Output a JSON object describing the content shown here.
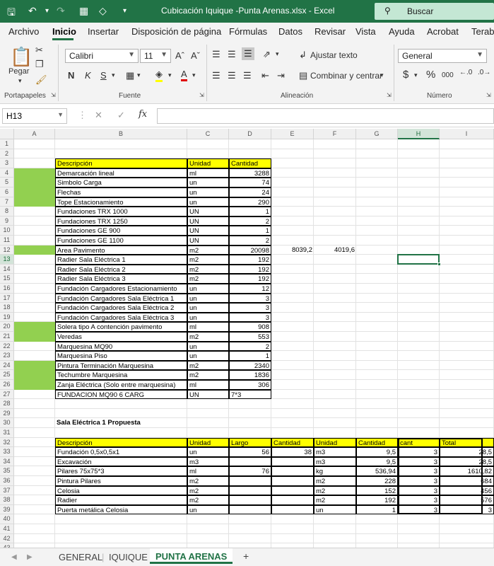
{
  "titlebar": {
    "title": "Cubicación Iquique -Punta Arenas.xlsx  -  Excel",
    "search_label": "Buscar",
    "save_icon": "save-icon",
    "undo_icon": "undo-icon",
    "redo_icon": "redo-icon"
  },
  "ribbon_tabs": [
    "Archivo",
    "Inicio",
    "Insertar",
    "Disposición de página",
    "Fórmulas",
    "Datos",
    "Revisar",
    "Vista",
    "Ayuda",
    "Acrobat",
    "Terabo"
  ],
  "ribbon": {
    "paste_label": "Pegar",
    "font_name": "Calibri",
    "font_size": "11",
    "wrap_text_label": "Ajustar texto",
    "merge_label": "Combinar y centrar",
    "number_format": "General",
    "groups": {
      "clipboard": "Portapapeles",
      "font": "Fuente",
      "alignment": "Alineación",
      "number": "Número"
    },
    "bold": "N",
    "italic": "K",
    "underline": "S",
    "increase_font": "A^",
    "decrease_font": "A˅",
    "currency": "$",
    "percent": "%",
    "thousands": "000"
  },
  "formula_bar": {
    "name_box": "H13",
    "fx": "fx",
    "cancel": "✕",
    "enter": "✓",
    "content": ""
  },
  "columns": [
    "A",
    "B",
    "C",
    "D",
    "E",
    "F",
    "G",
    "H",
    "I"
  ],
  "selected_column": "H",
  "selected_row": 13,
  "rows": [
    1,
    2,
    3,
    4,
    5,
    6,
    7,
    8,
    9,
    10,
    11,
    12,
    13,
    14,
    15,
    16,
    17,
    18,
    19,
    20,
    21,
    22,
    23,
    24,
    25,
    26,
    27,
    28,
    29,
    30,
    31,
    32,
    33,
    34,
    35,
    36,
    37,
    38,
    39,
    40,
    41,
    42,
    43
  ],
  "table1": {
    "headers": [
      "Descripción",
      "Unidad",
      "Cantidad"
    ],
    "rows": [
      {
        "desc": "Demarcación lineal",
        "unit": "ml",
        "qty": "3288",
        "green": true
      },
      {
        "desc": "Simbolo Carga",
        "unit": "un",
        "qty": "74",
        "green": true
      },
      {
        "desc": "Flechas",
        "unit": "un",
        "qty": "24",
        "green": true
      },
      {
        "desc": "Tope Estacionamiento",
        "unit": "un",
        "qty": "290",
        "green": true
      },
      {
        "desc": "Fundaciones TRX 1000",
        "unit": "UN",
        "qty": "1",
        "green": false
      },
      {
        "desc": "Fundaciones TRX 1250",
        "unit": "UN",
        "qty": "2",
        "green": false
      },
      {
        "desc": "Fundaciones GE 900",
        "unit": "UN",
        "qty": "1",
        "green": false
      },
      {
        "desc": "Fundaciones GE 1100",
        "unit": "UN",
        "qty": "2",
        "green": false
      },
      {
        "desc": "Area Pavimento",
        "unit": "m2",
        "qty": "20098",
        "green": true,
        "e": "8039,2",
        "f": "4019,6"
      },
      {
        "desc": "Radier Sala Eléctrica 1",
        "unit": "m2",
        "qty": "192",
        "green": false
      },
      {
        "desc": "Radier Sala Eléctrica 2",
        "unit": "m2",
        "qty": "192",
        "green": false
      },
      {
        "desc": "Radier Sala Eléctrica 3",
        "unit": "m2",
        "qty": "192",
        "green": false
      },
      {
        "desc": "Fundación Cargadores Estacionamiento",
        "unit": "un",
        "qty": "12",
        "green": false
      },
      {
        "desc": "Fundación Cargadores Sala Eléctrica 1",
        "unit": "un",
        "qty": "3",
        "green": false
      },
      {
        "desc": "Fundación Cargadores Sala Eléctrica 2",
        "unit": "un",
        "qty": "3",
        "green": false
      },
      {
        "desc": "Fundación Cargadores Sala Eléctrica 3",
        "unit": "un",
        "qty": "3",
        "green": false
      },
      {
        "desc": "Solera tipo A contención pavimento",
        "unit": "ml",
        "qty": "908",
        "green": true
      },
      {
        "desc": "Veredas",
        "unit": "m2",
        "qty": "553",
        "green": true
      },
      {
        "desc": "Marquesina MQ90",
        "unit": "un",
        "qty": "2",
        "green": false
      },
      {
        "desc": "Marquesina Piso",
        "unit": "un",
        "qty": "1",
        "green": false
      },
      {
        "desc": "Pintura Terminación Marquesina",
        "unit": "m2",
        "qty": "2340",
        "green": true
      },
      {
        "desc": "Techumbre Marquesina",
        "unit": "m2",
        "qty": "1836",
        "green": true
      },
      {
        "desc": "Zanja Eléctrica (Solo entre marquesina)",
        "unit": "ml",
        "qty": "306",
        "green": true
      },
      {
        "desc": "FUNDACION MQ90 6 CARG",
        "unit": "UN",
        "qty": "7*3",
        "green": false,
        "left": true
      }
    ]
  },
  "section_title": "Sala Eléctrica 1 Propuesta",
  "table2": {
    "headers": [
      "Descripción",
      "Unidad",
      "Largo",
      "Cantidad",
      "Unidad",
      "Cantidad",
      "cant",
      "Total"
    ],
    "rows": [
      [
        "Fundación 0,5x0,5x1",
        "un",
        "56",
        "38",
        "m3",
        "9,5",
        "3",
        "28,5"
      ],
      [
        "Excavación",
        "m3",
        "",
        "",
        "m3",
        "9,5",
        "3",
        "28,5"
      ],
      [
        "Pilares 75x75*3",
        "ml",
        "76",
        "",
        "kg",
        "536,94",
        "3",
        "1610,82"
      ],
      [
        "Pintura Pilares",
        "m2",
        "",
        "",
        "m2",
        "228",
        "3",
        "684"
      ],
      [
        "Celosia",
        "m2",
        "",
        "",
        "m2",
        "152",
        "3",
        "456"
      ],
      [
        "Radier",
        "m2",
        "",
        "",
        "m2",
        "192",
        "3",
        "576"
      ],
      [
        "Puerta metálica Celosia",
        "un",
        "",
        "",
        "un",
        "1",
        "3",
        "3"
      ]
    ]
  },
  "sheet_tabs": [
    "GENERAL",
    "IQUIQUE",
    "PUNTA ARENAS"
  ],
  "active_sheet": "PUNTA ARENAS",
  "add_sheet": "+"
}
